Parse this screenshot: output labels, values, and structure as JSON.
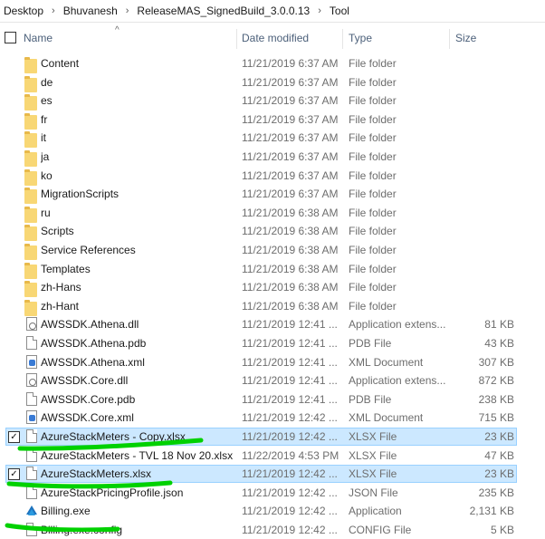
{
  "breadcrumb": [
    "Desktop",
    "Bhuvanesh",
    "ReleaseMAS_SignedBuild_3.0.0.13",
    "Tool"
  ],
  "breadcrumb_separator": "›",
  "columns": {
    "name": "Name",
    "date": "Date modified",
    "type": "Type",
    "size": "Size"
  },
  "sort_indicator": "^",
  "check_mark": "✓",
  "files": [
    {
      "name": "Content",
      "date": "11/21/2019 6:37 AM",
      "type": "File folder",
      "size": "",
      "icon": "folder-icon",
      "checked": false
    },
    {
      "name": "de",
      "date": "11/21/2019 6:37 AM",
      "type": "File folder",
      "size": "",
      "icon": "folder-icon",
      "checked": false
    },
    {
      "name": "es",
      "date": "11/21/2019 6:37 AM",
      "type": "File folder",
      "size": "",
      "icon": "folder-icon",
      "checked": false
    },
    {
      "name": "fr",
      "date": "11/21/2019 6:37 AM",
      "type": "File folder",
      "size": "",
      "icon": "folder-icon",
      "checked": false
    },
    {
      "name": "it",
      "date": "11/21/2019 6:37 AM",
      "type": "File folder",
      "size": "",
      "icon": "folder-icon",
      "checked": false
    },
    {
      "name": "ja",
      "date": "11/21/2019 6:37 AM",
      "type": "File folder",
      "size": "",
      "icon": "folder-icon",
      "checked": false
    },
    {
      "name": "ko",
      "date": "11/21/2019 6:37 AM",
      "type": "File folder",
      "size": "",
      "icon": "folder-icon",
      "checked": false
    },
    {
      "name": "MigrationScripts",
      "date": "11/21/2019 6:37 AM",
      "type": "File folder",
      "size": "",
      "icon": "folder-icon",
      "checked": false
    },
    {
      "name": "ru",
      "date": "11/21/2019 6:38 AM",
      "type": "File folder",
      "size": "",
      "icon": "folder-icon",
      "checked": false
    },
    {
      "name": "Scripts",
      "date": "11/21/2019 6:38 AM",
      "type": "File folder",
      "size": "",
      "icon": "folder-icon",
      "checked": false
    },
    {
      "name": "Service References",
      "date": "11/21/2019 6:38 AM",
      "type": "File folder",
      "size": "",
      "icon": "folder-icon",
      "checked": false
    },
    {
      "name": "Templates",
      "date": "11/21/2019 6:38 AM",
      "type": "File folder",
      "size": "",
      "icon": "folder-icon",
      "checked": false
    },
    {
      "name": "zh-Hans",
      "date": "11/21/2019 6:38 AM",
      "type": "File folder",
      "size": "",
      "icon": "folder-icon",
      "checked": false
    },
    {
      "name": "zh-Hant",
      "date": "11/21/2019 6:38 AM",
      "type": "File folder",
      "size": "",
      "icon": "folder-icon",
      "checked": false
    },
    {
      "name": "AWSSDK.Athena.dll",
      "date": "11/21/2019 12:41 ...",
      "type": "Application extens...",
      "size": "81 KB",
      "icon": "gear-file-icon",
      "checked": false
    },
    {
      "name": "AWSSDK.Athena.pdb",
      "date": "11/21/2019 12:41 ...",
      "type": "PDB File",
      "size": "43 KB",
      "icon": "file-icon",
      "checked": false
    },
    {
      "name": "AWSSDK.Athena.xml",
      "date": "11/21/2019 12:41 ...",
      "type": "XML Document",
      "size": "307 KB",
      "icon": "xml-icon",
      "checked": false
    },
    {
      "name": "AWSSDK.Core.dll",
      "date": "11/21/2019 12:41 ...",
      "type": "Application extens...",
      "size": "872 KB",
      "icon": "gear-file-icon",
      "checked": false
    },
    {
      "name": "AWSSDK.Core.pdb",
      "date": "11/21/2019 12:41 ...",
      "type": "PDB File",
      "size": "238 KB",
      "icon": "file-icon",
      "checked": false
    },
    {
      "name": "AWSSDK.Core.xml",
      "date": "11/21/2019 12:42 ...",
      "type": "XML Document",
      "size": "715 KB",
      "icon": "xml-icon",
      "checked": false
    },
    {
      "name": "AzureStackMeters - Copy.xlsx",
      "date": "11/21/2019 12:42 ...",
      "type": "XLSX File",
      "size": "23 KB",
      "icon": "file-icon",
      "checked": true
    },
    {
      "name": "AzureStackMeters - TVL 18 Nov 20.xlsx",
      "date": "11/22/2019 4:53 PM",
      "type": "XLSX File",
      "size": "47 KB",
      "icon": "file-icon",
      "checked": false
    },
    {
      "name": "AzureStackMeters.xlsx",
      "date": "11/21/2019 12:42 ...",
      "type": "XLSX File",
      "size": "23 KB",
      "icon": "file-icon",
      "checked": true
    },
    {
      "name": "AzureStackPricingProfile.json",
      "date": "11/21/2019 12:42 ...",
      "type": "JSON File",
      "size": "235 KB",
      "icon": "file-icon",
      "checked": false
    },
    {
      "name": "Billing.exe",
      "date": "11/21/2019 12:42 ...",
      "type": "Application",
      "size": "2,131 KB",
      "icon": "exe-icon",
      "checked": false
    },
    {
      "name": "Billing.exe.config",
      "date": "11/21/2019 12:42 ...",
      "type": "CONFIG File",
      "size": "5 KB",
      "icon": "file-icon",
      "checked": false
    }
  ],
  "colors": {
    "selection": "#cce8ff",
    "selection_border": "#99d1ff",
    "annotation": "#00d100",
    "folder": "#f8d775"
  }
}
